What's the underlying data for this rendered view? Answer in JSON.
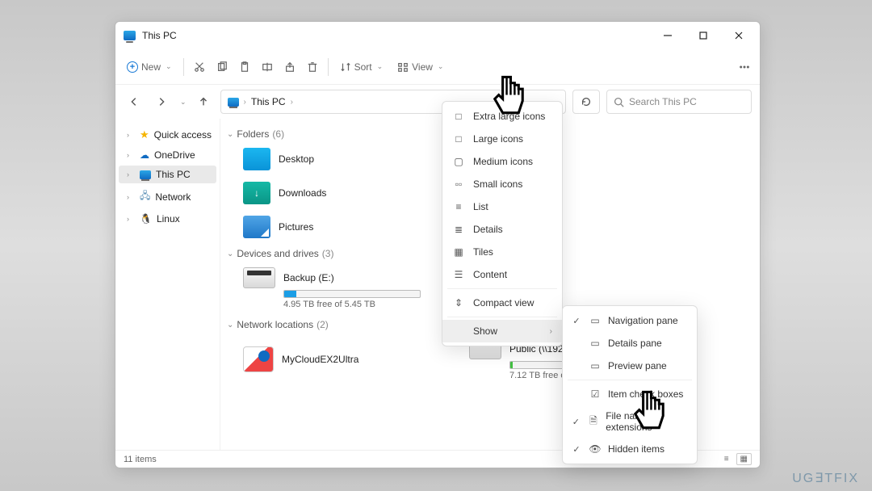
{
  "window": {
    "title": "This PC"
  },
  "toolbar": {
    "new_label": "New",
    "sort_label": "Sort",
    "view_label": "View"
  },
  "address": {
    "breadcrumb": "This PC"
  },
  "search": {
    "placeholder": "Search This PC"
  },
  "sidebar": {
    "items": [
      {
        "label": "Quick access"
      },
      {
        "label": "OneDrive"
      },
      {
        "label": "This PC"
      },
      {
        "label": "Network"
      },
      {
        "label": "Linux"
      }
    ]
  },
  "groups": {
    "folders": {
      "name": "Folders",
      "count": "(6)"
    },
    "drives": {
      "name": "Devices and drives",
      "count": "(3)"
    },
    "network": {
      "name": "Network locations",
      "count": "(2)"
    }
  },
  "folders": [
    {
      "name": "Desktop"
    },
    {
      "name": "Downloads"
    },
    {
      "name": "Pictures"
    }
  ],
  "drives": [
    {
      "name": "Backup (E:)",
      "meta": "4.95 TB free of 5.45 TB",
      "fill_pct": 9,
      "color": "blue"
    },
    {
      "name": "Public (\\\\192.168.0.216) (Z:)",
      "meta": "7.12 TB free of 7.21 TB",
      "fill_pct": 2,
      "color": "green"
    }
  ],
  "netloc": {
    "name": "MyCloudEX2Ultra"
  },
  "view_menu": {
    "items": [
      "Extra large icons",
      "Large icons",
      "Medium icons",
      "Small icons",
      "List",
      "Details",
      "Tiles",
      "Content",
      "Compact view",
      "Show"
    ]
  },
  "show_menu": {
    "items": [
      "Navigation pane",
      "Details pane",
      "Preview pane",
      "Item check boxes",
      "File name extensions",
      "Hidden items"
    ]
  },
  "status": {
    "count": "11 items"
  },
  "watermark": "UGETFIX"
}
